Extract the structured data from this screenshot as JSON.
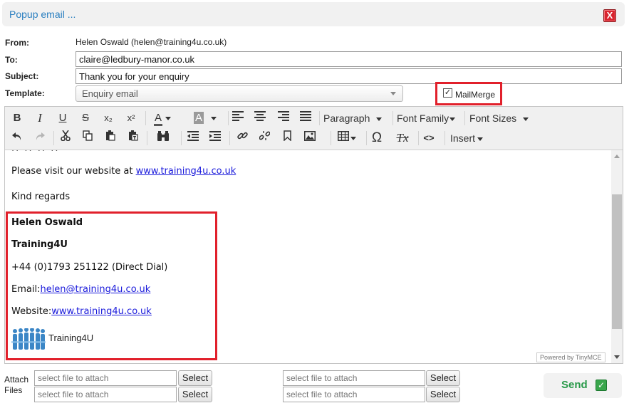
{
  "window": {
    "title": "Popup email ...",
    "close_label": "X"
  },
  "form": {
    "from_label": "From:",
    "from_value": "Helen Oswald (helen@training4u.co.uk)",
    "to_label": "To:",
    "to_value": "claire@ledbury-manor.co.uk",
    "subject_label": "Subject:",
    "subject_value": "Thank you for your enquiry",
    "template_label": "Template:",
    "template_value": "Enquiry email",
    "mailmerge_label": "MailMerge",
    "mailmerge_checked": true
  },
  "toolbar": {
    "bold": "B",
    "italic": "I",
    "underline": "U",
    "strike": "S",
    "subscript": "x₂",
    "superscript": "x²",
    "font_color": "A",
    "bg_color": "A",
    "paragraph": "Paragraph",
    "font_family": "Font Family",
    "font_sizes": "Font Sizes",
    "special_char": "Ω",
    "clear_format": "Tx",
    "code": "<>",
    "insert": "Insert"
  },
  "body": {
    "visit_text": "Please visit our website at ",
    "visit_link": "www.training4u.co.uk",
    "regards": "Kind regards",
    "sig_name": "Helen Oswald",
    "sig_company": "Training4U",
    "sig_phone": "+44 (0)1793 251122 (Direct Dial)",
    "sig_email_label": "Email:",
    "sig_email": "helen@training4u.co.uk",
    "sig_website_label": "Website:",
    "sig_website": "www.training4u.co.uk",
    "logo_text": "Training4U"
  },
  "powered_by": "Powered by TinyMCE",
  "attach": {
    "label": "Attach Files",
    "placeholder": "select file to attach",
    "select_label": "Select"
  },
  "send_label": "Send",
  "colors": {
    "accent_blue": "#2a7fc0",
    "highlight_red": "#e1202b",
    "send_green": "#2a9a4a"
  }
}
